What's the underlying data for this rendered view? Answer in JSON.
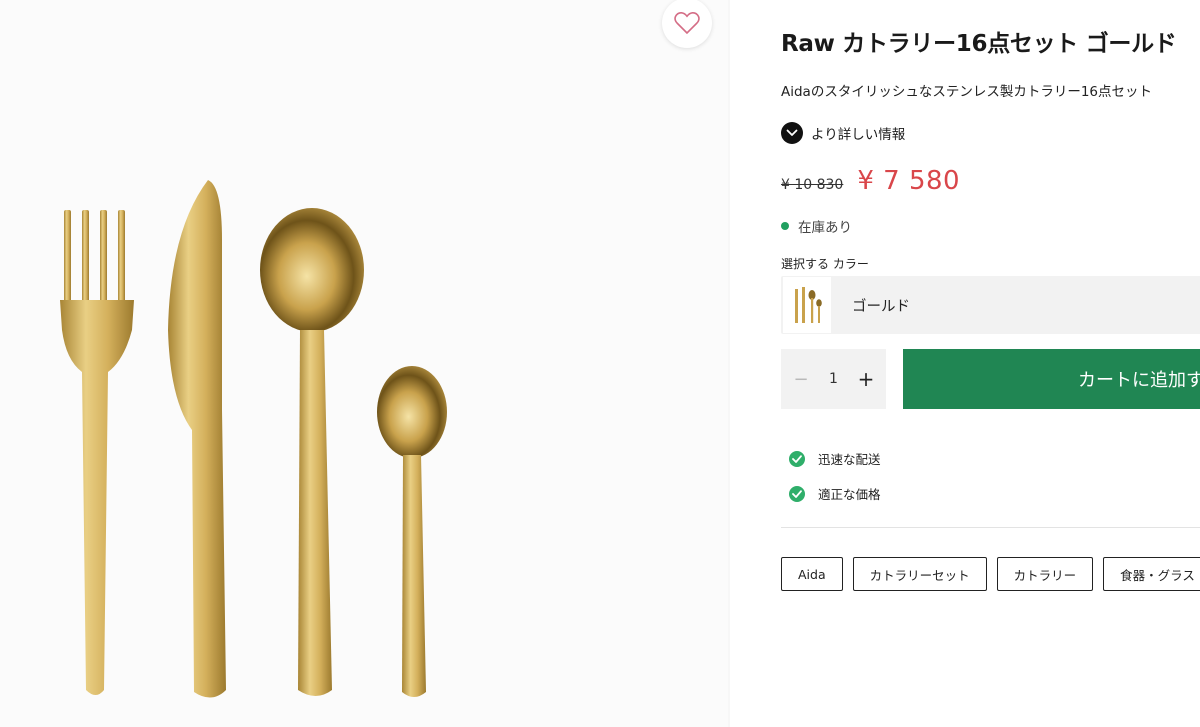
{
  "product": {
    "title": "Raw カトラリー16点セット ゴールド",
    "subtitle": "Aidaのスタイリッシュなステンレス製カトラリー16点セット",
    "more_info_label": "より詳しい情報",
    "old_price": "¥ 10 830",
    "new_price": "¥ 7 580",
    "stock_status": "在庫あり"
  },
  "color": {
    "label": "選択する カラー",
    "selected": "ゴールド"
  },
  "quantity": {
    "value": "1",
    "minus": "−",
    "plus": "+"
  },
  "cart_button_label": "カートに追加す",
  "benefits": [
    {
      "label": "迅速な配送"
    },
    {
      "label": "適正な価格"
    }
  ],
  "tags": [
    {
      "label": "Aida"
    },
    {
      "label": "カトラリーセット"
    },
    {
      "label": "カトラリー"
    },
    {
      "label": "食器・グラス"
    }
  ],
  "colors": {
    "accent_green": "#208653",
    "price_red": "#d9464a",
    "stock_green": "#21a060",
    "gold": "#d8b55a"
  },
  "icons": {
    "wishlist": "heart-icon",
    "more_info": "chevron-down-icon",
    "benefit": "check-icon"
  }
}
